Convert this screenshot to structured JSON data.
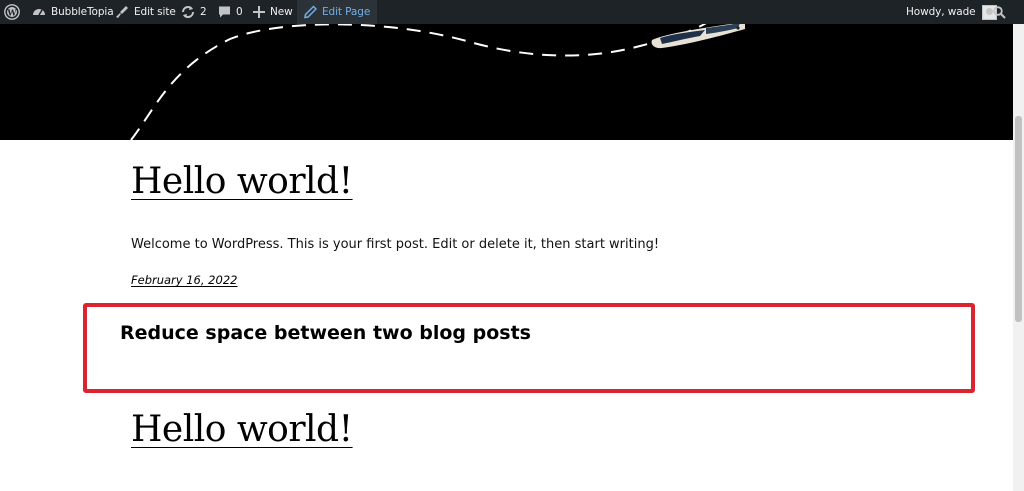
{
  "admin_bar": {
    "site_name": "BubbleTopia",
    "edit_site": "Edit site",
    "updates_count": "2",
    "comments_count": "0",
    "new_label": "New",
    "edit_page": "Edit Page",
    "greeting": "Howdy, wade"
  },
  "posts": [
    {
      "title": "Hello world!",
      "excerpt": "Welcome to WordPress. This is your first post. Edit or delete it, then start writing!",
      "date": "February 16, 2022"
    },
    {
      "title": "Hello world!"
    }
  ],
  "annotation": {
    "text": "Reduce space between two blog posts",
    "border_color": "#dc2430"
  },
  "colors": {
    "admin_bar_bg": "#1d2327",
    "admin_bar_text": "#f0f0f1",
    "edit_page_highlight": "#72aee6",
    "hero_bg": "#000000"
  },
  "icons": {
    "wordpress": "wordpress-logo-icon",
    "site": "dashboard-icon",
    "edit_site": "paintbrush-icon",
    "updates": "updates-icon",
    "comments": "comment-bubble-icon",
    "new": "plus-icon",
    "edit_page": "pencil-icon",
    "search": "search-icon"
  }
}
